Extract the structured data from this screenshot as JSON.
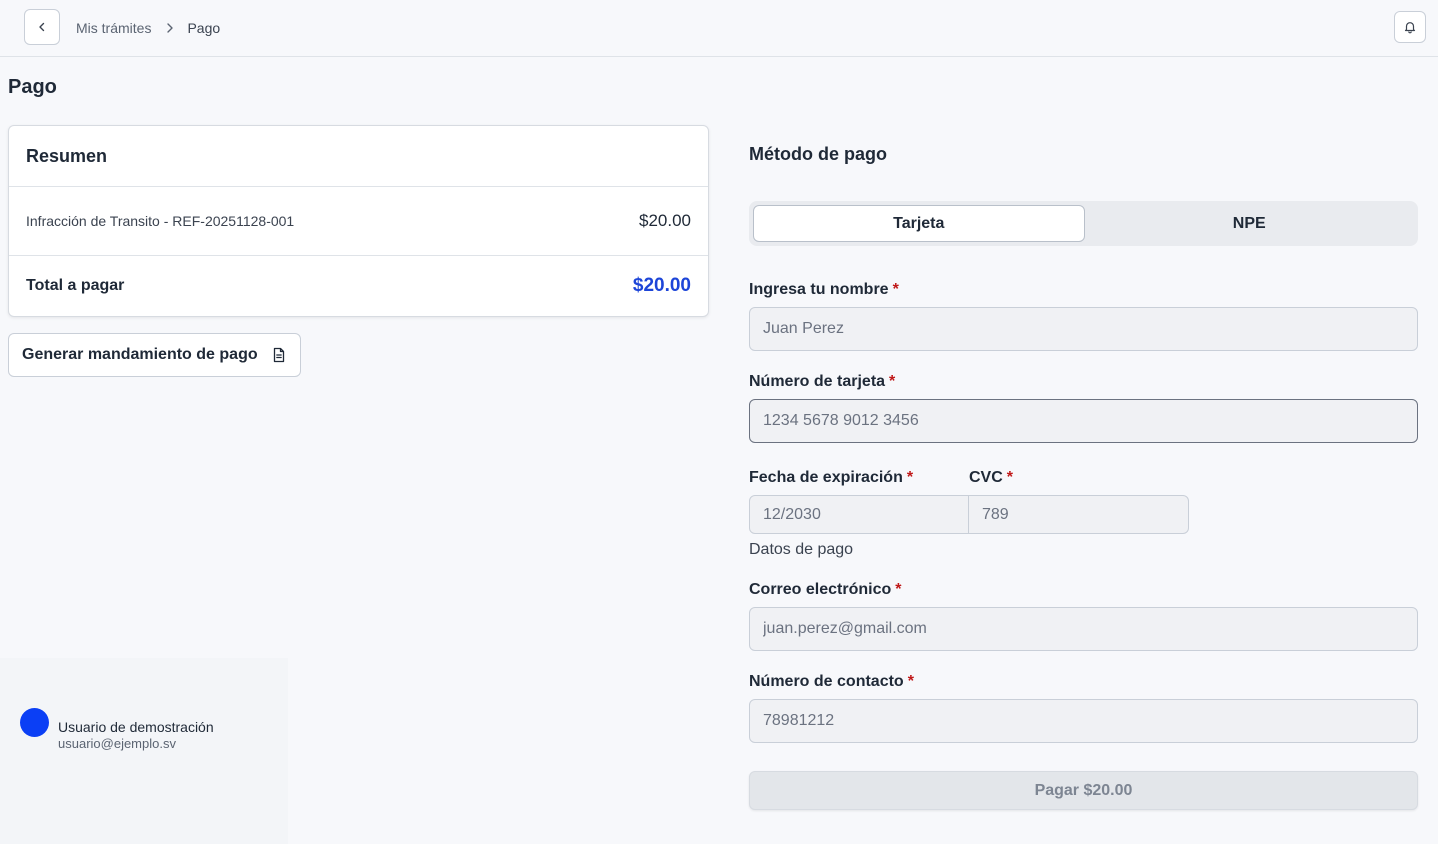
{
  "breadcrumb": {
    "parent": "Mis trámites",
    "current": "Pago"
  },
  "page": {
    "title": "Pago"
  },
  "summary": {
    "title": "Resumen",
    "item_description": "Infracción de Transito - REF-20251128-001",
    "item_amount": "$20.00",
    "total_label": "Total a pagar",
    "total_amount": "$20.00",
    "total_color": "#1d45d8"
  },
  "actions": {
    "generate_label": "Generar mandamiento de pago",
    "pay_label": "Pagar $20.00"
  },
  "user": {
    "name": "Usuario de demostración",
    "email": "usuario@ejemplo.sv",
    "avatar_color": "#0b3ff5"
  },
  "payment": {
    "title": "Método de pago",
    "tabs": [
      {
        "label": "Tarjeta",
        "active": true
      },
      {
        "label": "NPE",
        "active": false
      }
    ],
    "fields": {
      "name": {
        "label": "Ingresa tu nombre",
        "required": "*",
        "placeholder": "Juan Perez"
      },
      "card": {
        "label": "Número de tarjeta",
        "required": "*",
        "placeholder": "1234 5678 9012 3456"
      },
      "expiry": {
        "label": "Fecha de expiración",
        "required": "*",
        "placeholder": "12/2030"
      },
      "cvc": {
        "label": "CVC",
        "required": "*",
        "placeholder": "789"
      },
      "email": {
        "label": "Correo electrónico",
        "required": "*",
        "placeholder": "juan.perez@gmail.com"
      },
      "phone": {
        "label": "Número de contacto",
        "required": "*",
        "placeholder": "78981212"
      }
    },
    "helper_text": "Datos de pago"
  },
  "icons": {
    "back": "chevron-left-icon",
    "separator": "chevron-right-icon",
    "notifications": "bell-icon",
    "document": "document-icon"
  }
}
